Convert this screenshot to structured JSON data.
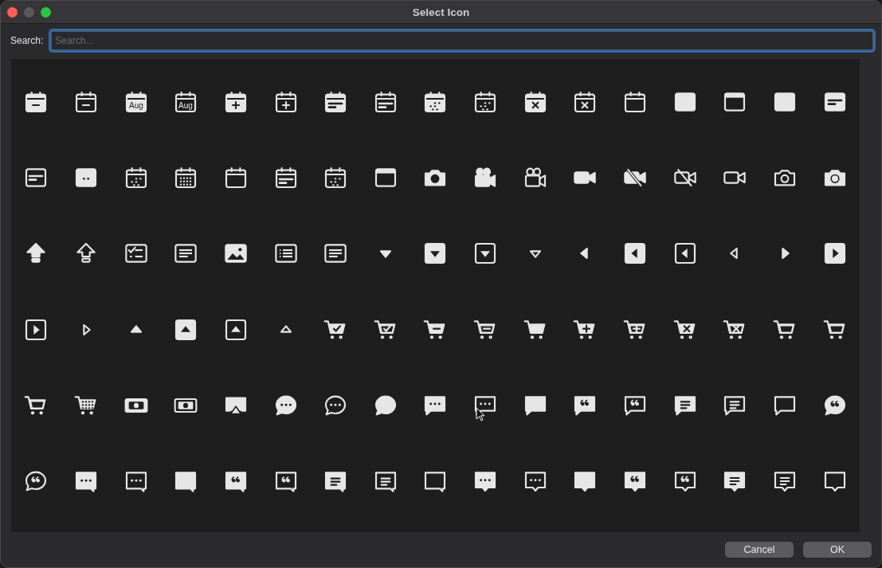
{
  "window": {
    "title": "Select Icon"
  },
  "search": {
    "label": "Search:",
    "placeholder": "Search...",
    "focused": true
  },
  "icon_grid": {
    "month_labels": [
      "Aug",
      "Aug"
    ]
  },
  "buttons": [
    {
      "label": "Cancel"
    },
    {
      "label": "OK"
    }
  ]
}
